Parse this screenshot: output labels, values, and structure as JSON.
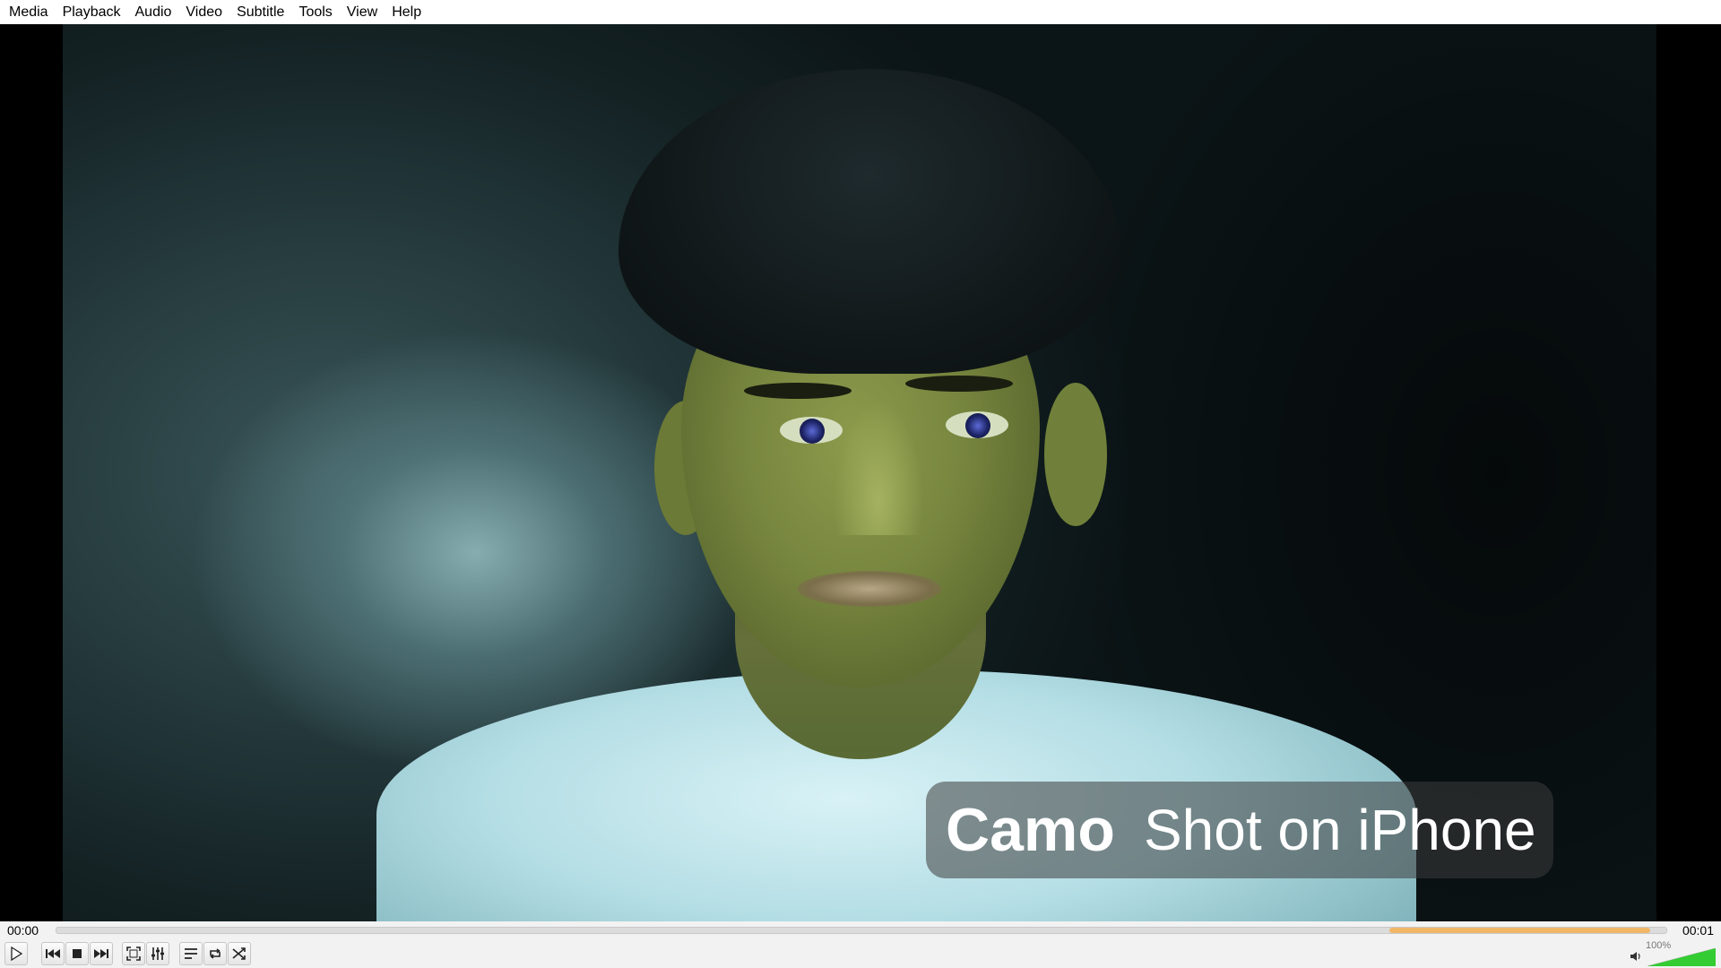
{
  "menu": {
    "items": [
      "Media",
      "Playback",
      "Audio",
      "Video",
      "Subtitle",
      "Tools",
      "View",
      "Help"
    ]
  },
  "video": {
    "watermark": {
      "brand": "Camo",
      "text": "Shot on iPhone"
    }
  },
  "seek": {
    "elapsed": "00:00",
    "total": "00:01",
    "buffered_start": 0.828,
    "buffered_end": 0.99
  },
  "controls": {
    "buttons": [
      {
        "name": "play-button",
        "icon": "play-icon"
      },
      {
        "name": "previous-button",
        "icon": "skip-previous-icon"
      },
      {
        "name": "stop-button",
        "icon": "stop-icon"
      },
      {
        "name": "next-button",
        "icon": "skip-next-icon"
      },
      {
        "name": "fullscreen-button",
        "icon": "fullscreen-icon"
      },
      {
        "name": "extended-settings-button",
        "icon": "equalizer-icon"
      },
      {
        "name": "playlist-button",
        "icon": "playlist-icon"
      },
      {
        "name": "loop-button",
        "icon": "loop-icon"
      },
      {
        "name": "shuffle-button",
        "icon": "shuffle-icon"
      }
    ],
    "volume": {
      "label": "100%",
      "level": 1.0,
      "icon": "speaker-icon",
      "color": "#33cc33"
    }
  },
  "colors": {
    "seek_buffered": "#f0b768",
    "menubar_bg": "#ffffff",
    "controls_bg": "#f2f2f2"
  }
}
